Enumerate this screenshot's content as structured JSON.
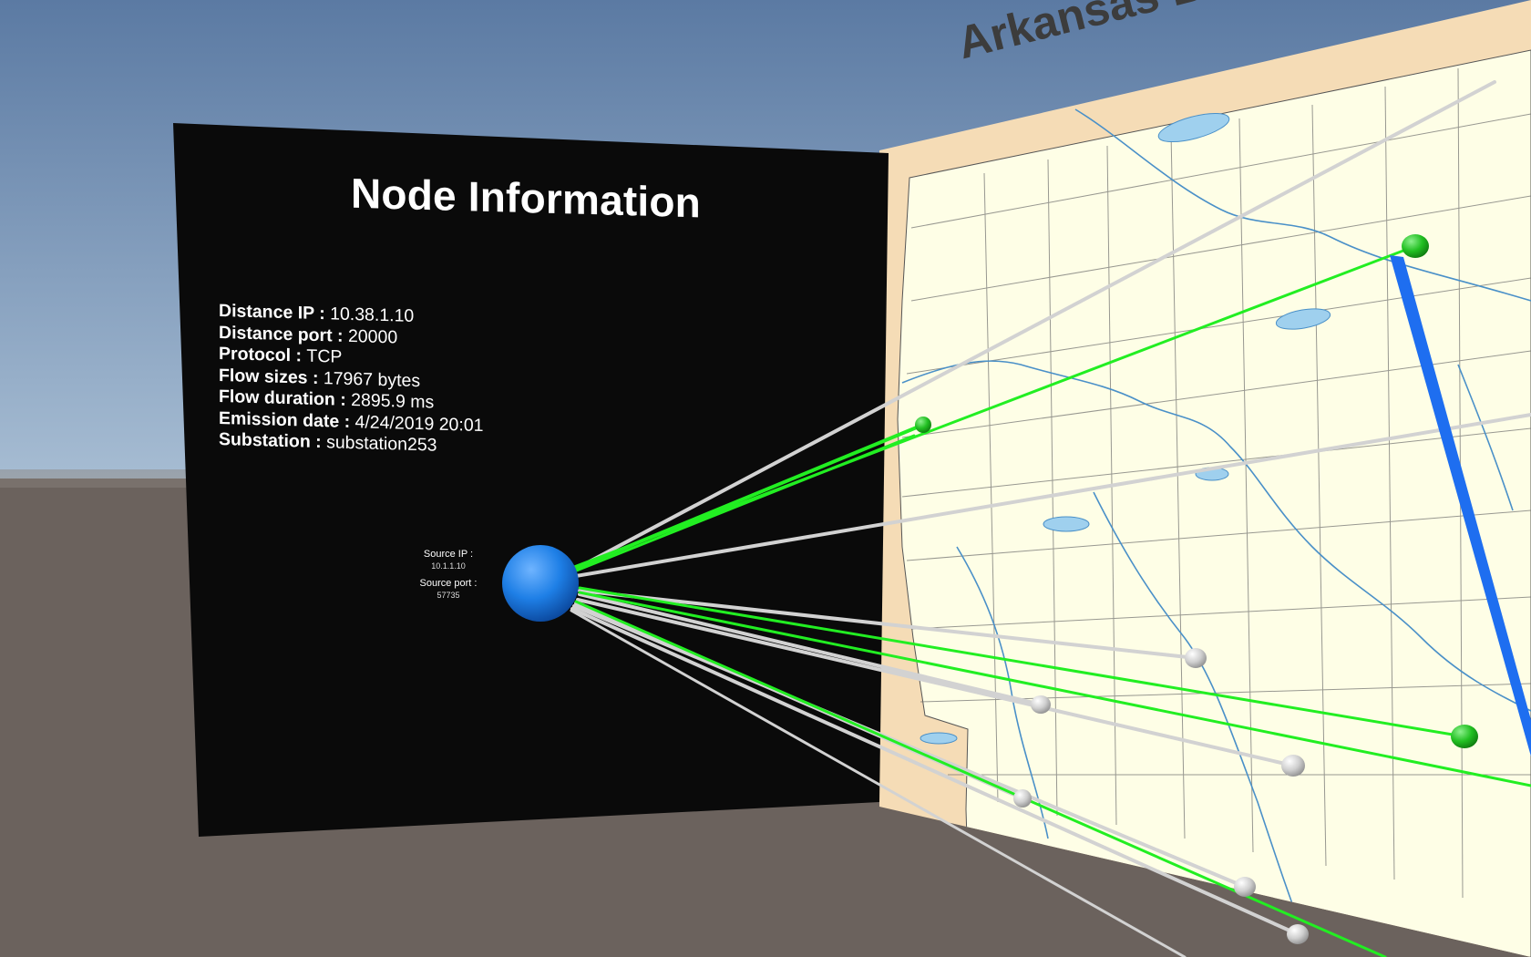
{
  "map": {
    "title": "Arkansas Bo"
  },
  "node_panel": {
    "title": "Node Information",
    "fields": [
      {
        "label": "Distance IP : ",
        "value": "10.38.1.10"
      },
      {
        "label": "Distance port : ",
        "value": "20000"
      },
      {
        "label": "Protocol : ",
        "value": "TCP"
      },
      {
        "label": "Flow sizes : ",
        "value": "17967 bytes"
      },
      {
        "label": "Flow duration : ",
        "value": "2895.9 ms"
      },
      {
        "label": "Emission date : ",
        "value": "4/24/2019 20:01"
      },
      {
        "label": "Substation : ",
        "value": "substation253"
      }
    ]
  },
  "source_node": {
    "ip_label": "Source IP :",
    "ip_value": "10.1.1.10",
    "port_label": "Source port :",
    "port_value": "57735",
    "color": "#1e7fe6"
  },
  "colors": {
    "sky_top": "#5b7aa3",
    "sky_bottom": "#9fb7cf",
    "ground": "#6b625d",
    "panel": "#0a0a0a",
    "map_land": "#fefee8",
    "map_border": "#f5dcb6",
    "river": "#4a90c8",
    "water": "#9fd0ee",
    "active_link": "#22ee22",
    "inactive_link": "#d6d6d6",
    "highlight_link": "#1e6ef0",
    "active_node": "#2cc12c",
    "inactive_node": "#c8c8c8"
  }
}
